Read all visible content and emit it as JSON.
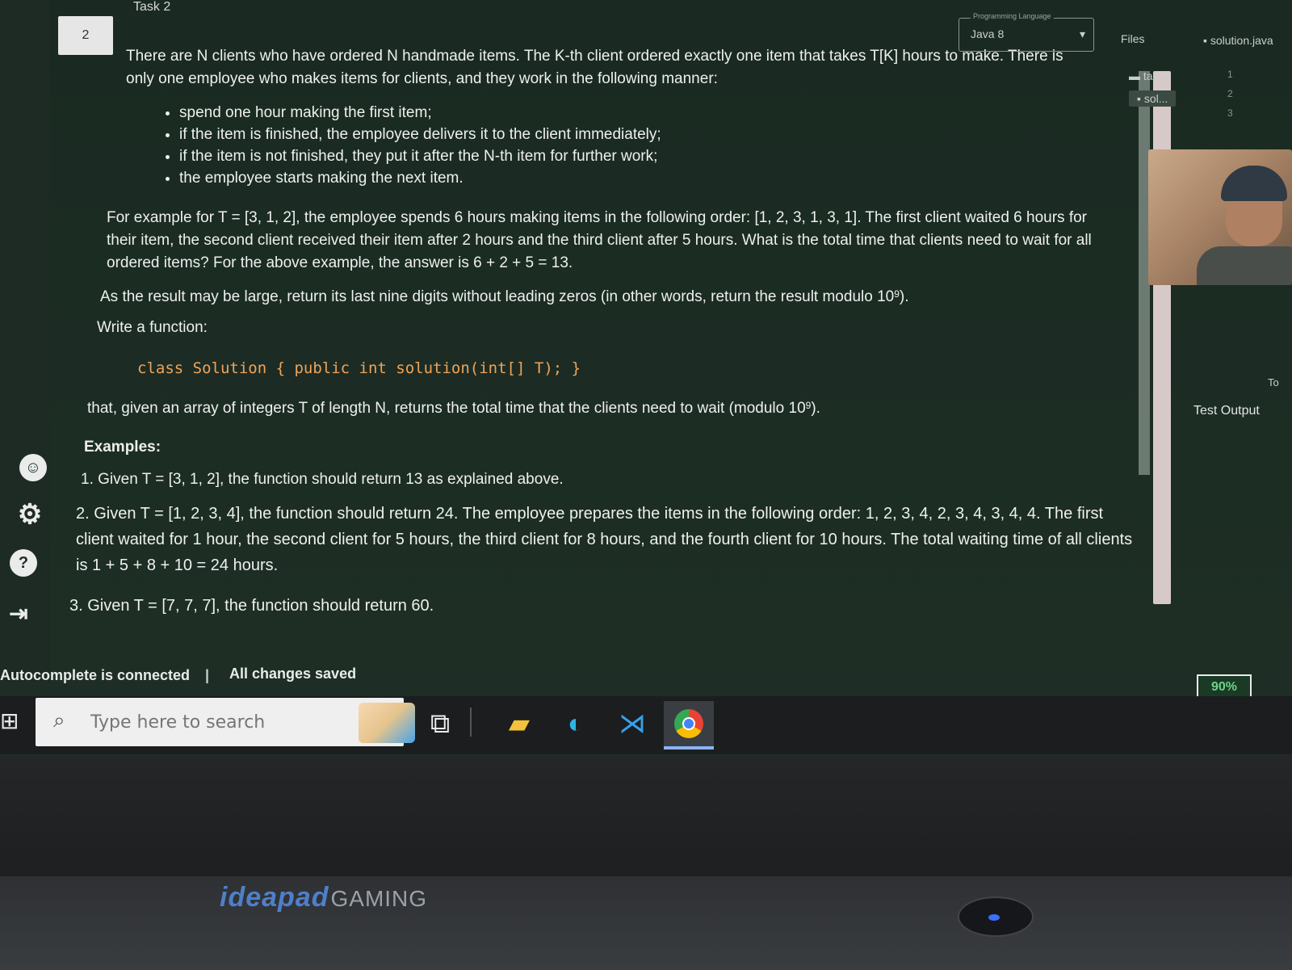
{
  "task": {
    "label": "Task 2",
    "number": "2"
  },
  "problem": {
    "intro": "There are N clients who have ordered N handmade items. The K-th client ordered exactly one item that takes T[K] hours to make. There is only one employee who makes items for clients, and they work in the following manner:",
    "bullets": [
      "spend one hour making the first item;",
      "if the item is finished, the employee delivers it to the client immediately;",
      "if the item is not finished, they put it after the N-th item for further work;",
      "the employee starts making the next item."
    ],
    "example_paragraph": "For example for T = [3, 1, 2], the employee spends 6 hours making items in the following order: [1, 2, 3, 1, 3, 1]. The first client waited 6 hours for their item, the second client received their item after 2 hours and the third client after 5 hours. What is the total time that clients need to wait for all ordered items? For the above example, the answer is 6 + 2 + 5 = 13.",
    "result_note_pre": "As the result may be large, return its last nine digits without leading zeros (in other words, return the result modulo 10",
    "result_note_exp": "9",
    "result_note_post": ").",
    "write_function": "Write a function:",
    "signature": "class Solution { public int solution(int[] T); }",
    "given_pre": "that, given an array of integers T of length N, returns the total time that the clients need to wait (modulo 10",
    "given_exp": "9",
    "given_post": ").",
    "examples_heading": "Examples:",
    "examples": [
      "1. Given T = [3, 1, 2], the function should return 13 as explained above.",
      "2. Given T = [1, 2, 3, 4], the function should return 24. The employee prepares the items in the following order: 1, 2, 3, 4, 2, 3, 4, 3, 4, 4. The first client waited for 1 hour, the second client for 5 hours, the third client for 8 hours, and the fourth client for 10 hours. The total waiting time of all clients is 1 + 5 + 8 + 10 = 24 hours.",
      "3. Given T = [7, 7, 7], the function should return 60."
    ]
  },
  "editor": {
    "language_caption": "Programming Language",
    "language_value": "Java 8",
    "files_label": "Files",
    "file_tab": "solution.java",
    "tree_folder": "task2",
    "tree_file": "sol...",
    "line_numbers": [
      "1",
      "2",
      "3"
    ],
    "test_output_label": "Test Output",
    "to_label": "To"
  },
  "status": {
    "autocomplete": "Autocomplete is connected",
    "separator": "|",
    "saved": "All changes saved",
    "zoom": "90%"
  },
  "taskbar": {
    "search_placeholder": "Type here to search"
  },
  "laptop": {
    "brand_main": "ideapad",
    "brand_sub": "GAMING"
  },
  "icons": {
    "start": "windows-start-icon",
    "search": "magnifier-icon",
    "taskview": "task-view-icon",
    "explorer": "file-explorer-icon",
    "edge": "edge-icon",
    "vscode": "vscode-icon",
    "chrome": "chrome-icon"
  }
}
